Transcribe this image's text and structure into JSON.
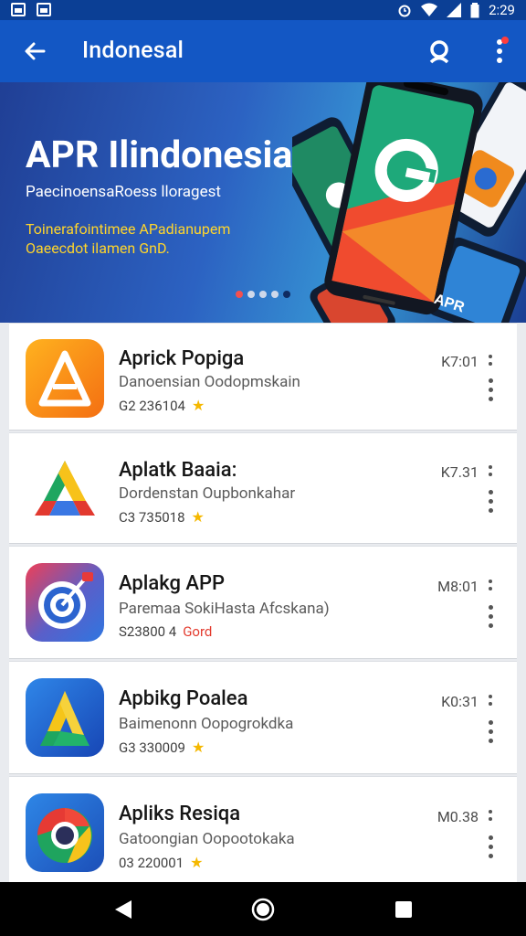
{
  "status_bar": {
    "time": "2:29",
    "icons": [
      "gallery-icon",
      "image-icon",
      "alarm-icon",
      "wifi-icon",
      "signal-icon",
      "battery-icon"
    ]
  },
  "app_bar": {
    "title": "Indonesal",
    "back_icon": "arrow-left-icon",
    "search_icon": "search-icon",
    "menu_icon": "more-vert-icon"
  },
  "banner": {
    "title": "APR Ilindonesia",
    "subtitle": "PaecinoensaRoess lloragest",
    "line1": "Toinerafointimee APadianupem",
    "line2": "Oaeecdot ilamen GnD.",
    "phone_back_label": "APR",
    "carousel_dots": 5,
    "active_dot": 0
  },
  "apps": [
    {
      "name": "Aprick Popiga",
      "developer": "Danoensian Oodopmskain",
      "meta": "G2 236104",
      "size": "K7:01",
      "badge_type": "star",
      "icon": "app-icon-orange-a"
    },
    {
      "name": "Aplatk Baaia:",
      "developer": "Dordenstan Oupbonkahar",
      "meta": "C3 735018",
      "size": "K7.31",
      "badge_type": "star",
      "icon": "app-icon-triangle-a"
    },
    {
      "name": "Aplakg APP",
      "developer": "Paremaa SokiHasta Afcskana)",
      "meta": "S23800 4",
      "size": "M8:01",
      "badge_type": "text",
      "badge_text": "Gord",
      "icon": "app-icon-target"
    },
    {
      "name": "Apbikg Poalea",
      "developer": "Baimenonn Oopogrokdka",
      "meta": "G3 330009",
      "size": "K0:31",
      "badge_type": "star",
      "icon": "app-icon-blue-a"
    },
    {
      "name": "Apliks Resiqa",
      "developer": "Gatoongian Oopootokaka",
      "meta": "03 220001",
      "size": "M0.38",
      "badge_type": "star",
      "icon": "app-icon-chrome-like"
    }
  ],
  "colors": {
    "status_bar": "#0b3f95",
    "app_bar": "#1357c4",
    "accent_yellow": "#ffd52b",
    "star": "#f5b800",
    "badge_red": "#e33b2e"
  },
  "nav_bar": {
    "back_icon": "nav-back-triangle-icon",
    "home_icon": "nav-home-circle-icon",
    "recents_icon": "nav-recents-square-icon"
  }
}
